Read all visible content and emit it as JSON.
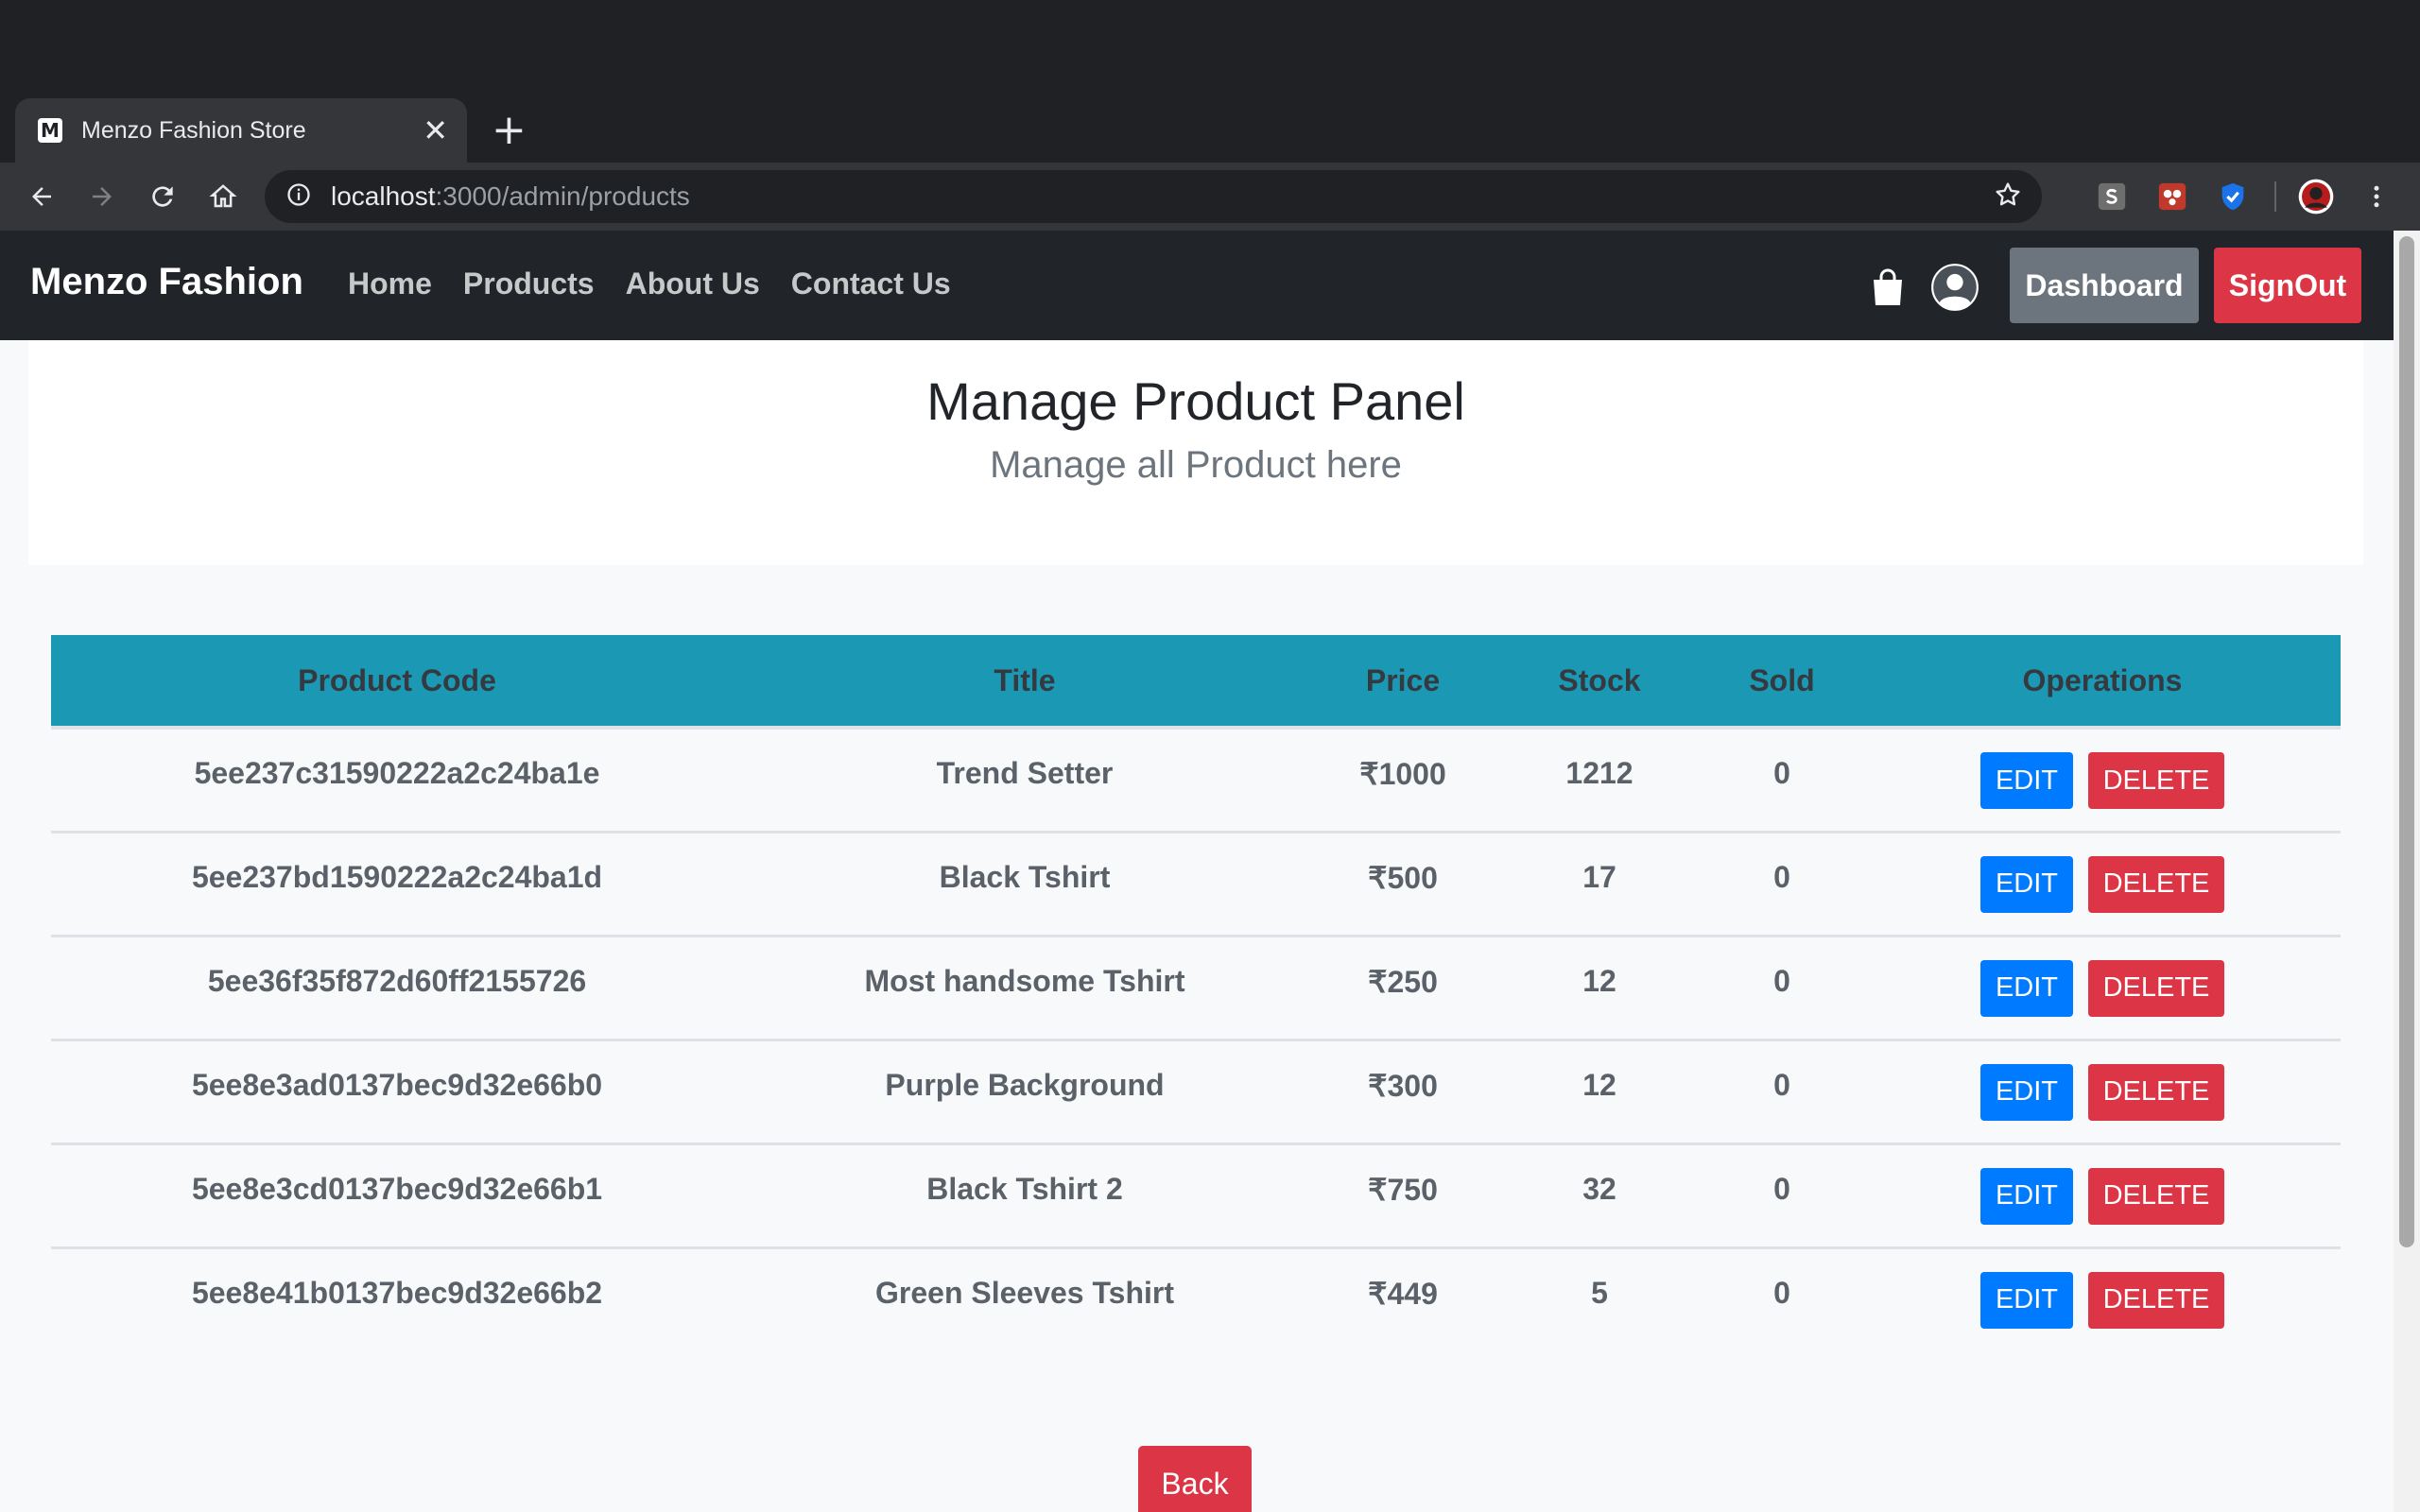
{
  "browser": {
    "tab_title": "Menzo Fashion Store",
    "tab_favicon": "M",
    "new_tab": "+",
    "close": "✕",
    "url_host": "localhost",
    "url_path": ":3000/admin/products"
  },
  "navbar": {
    "brand": "Menzo Fashion",
    "links": [
      "Home",
      "Products",
      "About Us",
      "Contact Us"
    ],
    "dashboard_label": "Dashboard",
    "signout_label": "SignOut"
  },
  "header": {
    "title": "Manage Product Panel",
    "subtitle": "Manage all Product here"
  },
  "table": {
    "columns": [
      "Product Code",
      "Title",
      "Price",
      "Stock",
      "Sold",
      "Operations"
    ],
    "rows": [
      {
        "code": "5ee237c31590222a2c24ba1e",
        "title": "Trend Setter",
        "price": "₹1000",
        "stock": "1212",
        "sold": "0"
      },
      {
        "code": "5ee237bd1590222a2c24ba1d",
        "title": "Black Tshirt",
        "price": "₹500",
        "stock": "17",
        "sold": "0"
      },
      {
        "code": "5ee36f35f872d60ff2155726",
        "title": "Most handsome Tshirt",
        "price": "₹250",
        "stock": "12",
        "sold": "0"
      },
      {
        "code": "5ee8e3ad0137bec9d32e66b0",
        "title": "Purple Background",
        "price": "₹300",
        "stock": "12",
        "sold": "0"
      },
      {
        "code": "5ee8e3cd0137bec9d32e66b1",
        "title": "Black Tshirt 2",
        "price": "₹750",
        "stock": "32",
        "sold": "0"
      },
      {
        "code": "5ee8e41b0137bec9d32e66b2",
        "title": "Green Sleeves Tshirt",
        "price": "₹449",
        "stock": "5",
        "sold": "0"
      }
    ],
    "edit_label": "EDIT",
    "delete_label": "DELETE"
  },
  "back_label": "Back",
  "colors": {
    "table_header": "#1b99b4",
    "edit": "#007bff",
    "delete": "#dc3545",
    "dashboard": "#6c757d",
    "navbar": "#212529"
  },
  "icons": [
    "back-arrow-icon",
    "forward-arrow-icon",
    "reload-icon",
    "home-icon",
    "info-icon",
    "star-icon",
    "shopping-bag-icon",
    "user-icon",
    "more-icon"
  ]
}
